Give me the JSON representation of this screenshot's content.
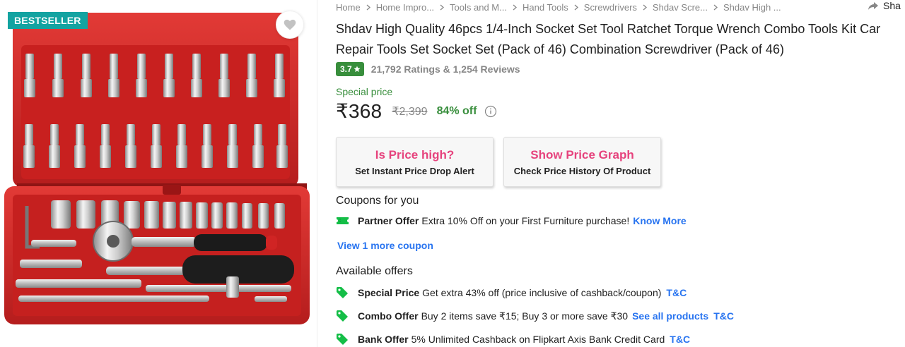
{
  "badge": {
    "label": "BESTSELLER"
  },
  "breadcrumb": [
    "Home",
    "Home Impro...",
    "Tools and M...",
    "Hand Tools",
    "Screwdrivers",
    "Shdav Scre...",
    "Shdav High ..."
  ],
  "share": {
    "label": "Sha"
  },
  "product": {
    "title": "Shdav High Quality 46pcs 1/4-Inch Socket Set Tool Ratchet Torque Wrench Combo Tools Kit Car Repair Tools Set Socket Set (Pack of 46) Combination Screwdriver  (Pack of 46)",
    "rating": "3.7",
    "rating_summary": "21,792 Ratings & 1,254 Reviews",
    "special_price_label": "Special price",
    "price": "₹368",
    "mrp": "₹2,399",
    "discount": "84% off"
  },
  "price_buttons": [
    {
      "main": "Is Price high?",
      "sub": "Set Instant Price Drop Alert"
    },
    {
      "main": "Show Price Graph",
      "sub": "Check Price History Of Product"
    }
  ],
  "coupons": {
    "heading": "Coupons for you",
    "items": [
      {
        "type": "Partner Offer",
        "text": "Extra 10% Off on your First Furniture purchase!",
        "link": "Know More"
      }
    ],
    "view_more": "View 1 more coupon"
  },
  "offers": {
    "heading": "Available offers",
    "items": [
      {
        "type": "Special Price",
        "text": "Get extra 43% off (price inclusive of cashback/coupon)",
        "link": "",
        "tc": "T&C"
      },
      {
        "type": "Combo Offer",
        "text": "Buy 2 items save ₹15; Buy 3 or more save ₹30",
        "link": "See all products",
        "tc": "T&C"
      },
      {
        "type": "Bank Offer",
        "text": "5% Unlimited Cashback on Flipkart Axis Bank Credit Card",
        "link": "",
        "tc": "T&C"
      }
    ]
  },
  "colors": {
    "badge": "#13a3a1",
    "rating": "#388e3c",
    "link": "#2874f0",
    "price_button_text": "#e6437d",
    "case_red": "#d42a2a"
  }
}
